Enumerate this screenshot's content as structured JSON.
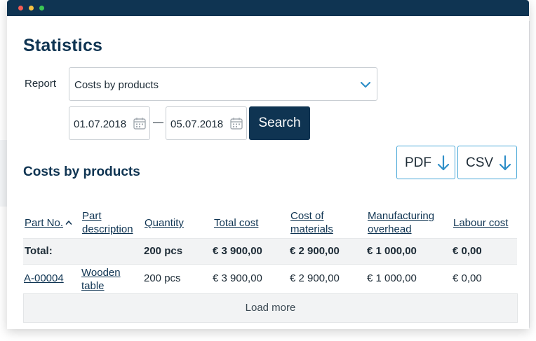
{
  "window": {
    "controls": [
      "close",
      "minimize",
      "maximize"
    ]
  },
  "page": {
    "title": "Statistics"
  },
  "filters": {
    "report_label": "Report",
    "report_selected": "Costs by products",
    "date_from": "01.07.2018",
    "date_separator": "—",
    "date_to": "05.07.2018",
    "search_label": "Search"
  },
  "section": {
    "title": "Costs by products",
    "export_pdf": "PDF",
    "export_csv": "CSV"
  },
  "table": {
    "headers": {
      "part_no": "Part No.",
      "part_description_1": "Part",
      "part_description_2": "description",
      "quantity": "Quantity",
      "total_cost": "Total cost",
      "cost_of_materials_1": "Cost of",
      "cost_of_materials_2": "materials",
      "manufacturing_overhead_1": "Manufacturing",
      "manufacturing_overhead_2": "overhead",
      "labour_cost": "Labour cost"
    },
    "total": {
      "label": "Total:",
      "quantity": "200 pcs",
      "total_cost": "€ 3 900,00",
      "cost_of_materials": "€ 2 900,00",
      "manufacturing_overhead": "€ 1 000,00",
      "labour_cost": "€ 0,00"
    },
    "rows": [
      {
        "part_no": "A-00004",
        "description_1": "Wooden",
        "description_2": "table",
        "quantity": "200 pcs",
        "total_cost": "€ 3 900,00",
        "cost_of_materials": "€ 2 900,00",
        "manufacturing_overhead": "€ 1 000,00",
        "labour_cost": "€ 0,00"
      }
    ],
    "load_more": "Load more"
  },
  "colors": {
    "primary": "#0f3452",
    "accent": "#4aa8d8",
    "row_background": "#f2f3f4"
  },
  "icons": {
    "report_dropdown": "chevron-down-icon",
    "date_picker": "calendar-icon",
    "export": "arrow-down-icon",
    "sort": "caret-up-icon"
  }
}
